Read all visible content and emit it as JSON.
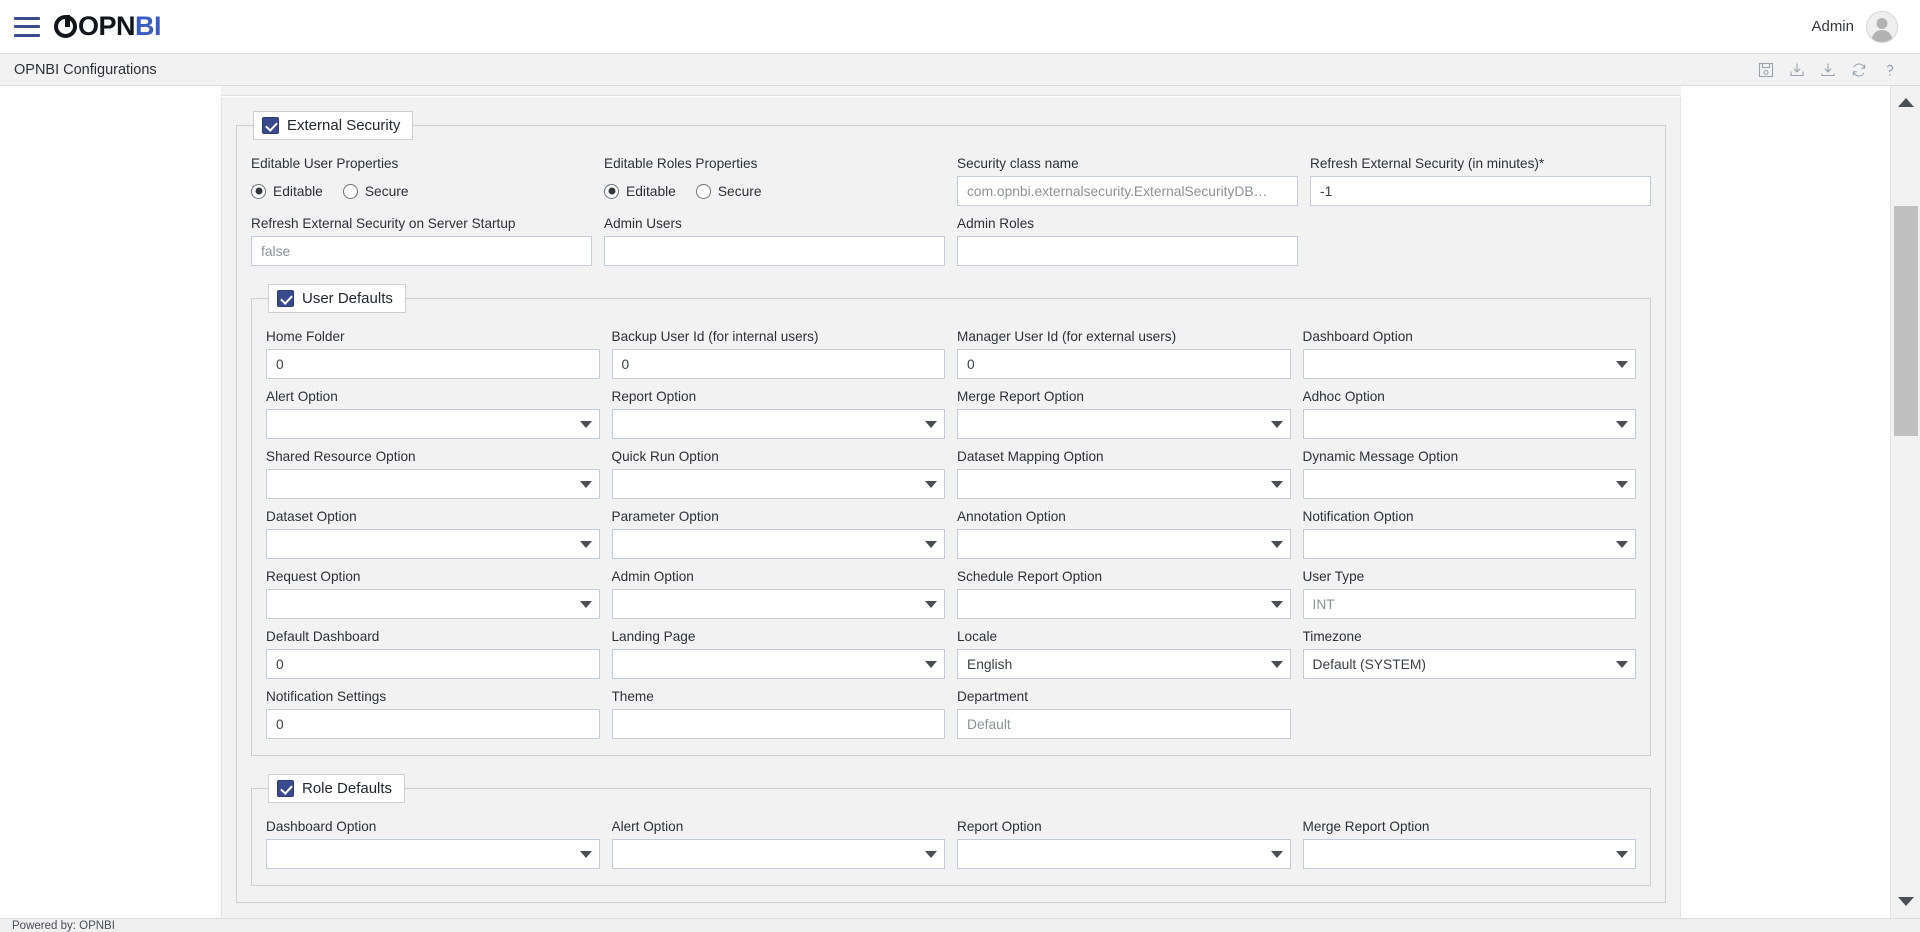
{
  "header": {
    "brand_opn": "OPN",
    "brand_bi": "BI",
    "user_label": "Admin"
  },
  "subheader": {
    "page_title": "OPNBI Configurations",
    "tools": [
      {
        "name": "save-icon",
        "title": "Save"
      },
      {
        "name": "download-icon",
        "title": "Download"
      },
      {
        "name": "import-icon",
        "title": "Import"
      },
      {
        "name": "refresh-icon",
        "title": "Refresh"
      },
      {
        "name": "help-icon",
        "title": "Help"
      }
    ]
  },
  "external_security": {
    "legend": "External Security",
    "editable_user_properties": {
      "label": "Editable User Properties",
      "options": [
        "Editable",
        "Secure"
      ],
      "selected": "Editable"
    },
    "editable_roles_properties": {
      "label": "Editable Roles Properties",
      "options": [
        "Editable",
        "Secure"
      ],
      "selected": "Editable"
    },
    "security_class_name": {
      "label": "Security class name",
      "value": "com.opnbi.externalsecurity.ExternalSecurityDB…"
    },
    "refresh_minutes": {
      "label": "Refresh External Security (in minutes)*",
      "value": "-1"
    },
    "refresh_on_startup": {
      "label": "Refresh External Security on Server Startup",
      "value": "false"
    },
    "admin_users": {
      "label": "Admin Users",
      "value": ""
    },
    "admin_roles": {
      "label": "Admin Roles",
      "value": ""
    }
  },
  "user_defaults": {
    "legend": "User Defaults",
    "rows": [
      [
        {
          "label": "Home Folder",
          "value": "0",
          "type": "text"
        },
        {
          "label": "Backup User Id (for internal users)",
          "value": "0",
          "type": "text"
        },
        {
          "label": "Manager User Id (for external users)",
          "value": "0",
          "type": "text"
        },
        {
          "label": "Dashboard Option",
          "value": "",
          "type": "select"
        }
      ],
      [
        {
          "label": "Alert Option",
          "value": "",
          "type": "select"
        },
        {
          "label": "Report Option",
          "value": "",
          "type": "select"
        },
        {
          "label": "Merge Report Option",
          "value": "",
          "type": "select"
        },
        {
          "label": "Adhoc Option",
          "value": "",
          "type": "select"
        }
      ],
      [
        {
          "label": "Shared Resource Option",
          "value": "",
          "type": "select"
        },
        {
          "label": "Quick Run Option",
          "value": "",
          "type": "select"
        },
        {
          "label": "Dataset Mapping Option",
          "value": "",
          "type": "select"
        },
        {
          "label": "Dynamic Message Option",
          "value": "",
          "type": "select"
        }
      ],
      [
        {
          "label": "Dataset Option",
          "value": "",
          "type": "select"
        },
        {
          "label": "Parameter Option",
          "value": "",
          "type": "select"
        },
        {
          "label": "Annotation Option",
          "value": "",
          "type": "select"
        },
        {
          "label": "Notification Option",
          "value": "",
          "type": "select"
        }
      ],
      [
        {
          "label": "Request Option",
          "value": "",
          "type": "select"
        },
        {
          "label": "Admin Option",
          "value": "",
          "type": "select"
        },
        {
          "label": "Schedule Report Option",
          "value": "",
          "type": "select"
        },
        {
          "label": "User Type",
          "value": "INT",
          "type": "text",
          "muted": true
        }
      ],
      [
        {
          "label": "Default Dashboard",
          "value": "0",
          "type": "text"
        },
        {
          "label": "Landing Page",
          "value": "",
          "type": "select"
        },
        {
          "label": "Locale",
          "value": "English",
          "type": "select"
        },
        {
          "label": "Timezone",
          "value": "Default (SYSTEM)",
          "type": "select"
        }
      ],
      [
        {
          "label": "Notification Settings",
          "value": "0",
          "type": "text"
        },
        {
          "label": "Theme",
          "value": "",
          "type": "text"
        },
        {
          "label": "Department",
          "value": "Default",
          "type": "text",
          "muted": true
        },
        {
          "label": "",
          "value": "",
          "type": "spacer"
        }
      ]
    ]
  },
  "role_defaults": {
    "legend": "Role Defaults",
    "rows": [
      [
        {
          "label": "Dashboard Option",
          "value": "",
          "type": "select"
        },
        {
          "label": "Alert Option",
          "value": "",
          "type": "select"
        },
        {
          "label": "Report Option",
          "value": "",
          "type": "select"
        },
        {
          "label": "Merge Report Option",
          "value": "",
          "type": "select"
        }
      ]
    ]
  },
  "footer": {
    "text": "Powered by: OPNBI"
  }
}
